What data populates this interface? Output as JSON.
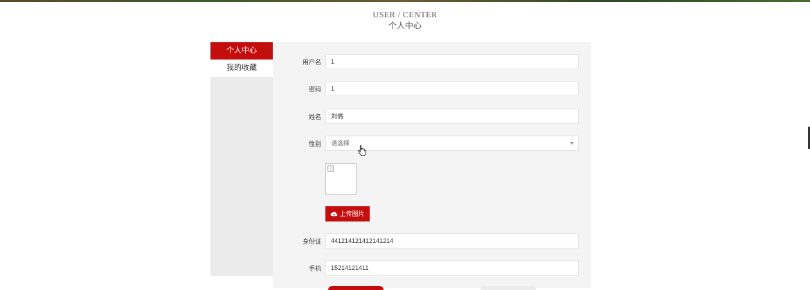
{
  "header": {
    "title_en": "USER / CENTER",
    "title_zh": "个人中心"
  },
  "sidebar": {
    "items": [
      {
        "label": "个人中心",
        "active": true
      },
      {
        "label": "我的收藏",
        "active": false
      }
    ]
  },
  "form": {
    "username": {
      "label": "用户名",
      "value": "1"
    },
    "password": {
      "label": "密码",
      "value": "1"
    },
    "name": {
      "label": "姓名",
      "value": "刘倩"
    },
    "gender": {
      "label": "性别",
      "placeholder": "请选择"
    },
    "upload_label": "上传图片",
    "id_card": {
      "label": "身份证",
      "value": "441214121412141214"
    },
    "phone": {
      "label": "手机",
      "value": "15214121411"
    }
  },
  "colors": {
    "accent": "#c40e0e",
    "sidebar_bg": "#ebebeb",
    "main_bg": "#f4f4f4"
  },
  "icons": {
    "upload": "cloud-upload-icon",
    "dropdown": "chevron-down-icon",
    "cursor": "hand-pointer-cursor"
  }
}
